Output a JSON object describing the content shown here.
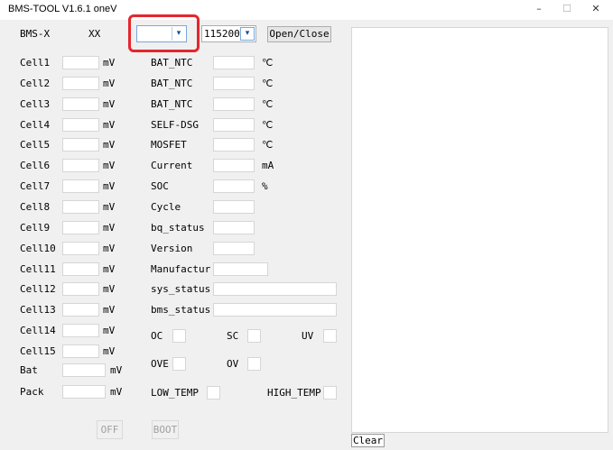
{
  "window": {
    "title": "BMS-TOOL V1.6.1  oneV",
    "minimize": "–",
    "maximize": "☐",
    "close": "✕"
  },
  "header": {
    "device_label": "BMS-X",
    "device_value": "XX",
    "port_value": "",
    "baud_value": "115200",
    "open_close_label": "Open/Close"
  },
  "cells": [
    {
      "label": "Cell1",
      "unit": "mV"
    },
    {
      "label": "Cell2",
      "unit": "mV"
    },
    {
      "label": "Cell3",
      "unit": "mV"
    },
    {
      "label": "Cell4",
      "unit": "mV"
    },
    {
      "label": "Cell5",
      "unit": "mV"
    },
    {
      "label": "Cell6",
      "unit": "mV"
    },
    {
      "label": "Cell7",
      "unit": "mV"
    },
    {
      "label": "Cell8",
      "unit": "mV"
    },
    {
      "label": "Cell9",
      "unit": "mV"
    },
    {
      "label": "Cell10",
      "unit": "mV"
    },
    {
      "label": "Cell11",
      "unit": "mV"
    },
    {
      "label": "Cell12",
      "unit": "mV"
    },
    {
      "label": "Cell13",
      "unit": "mV"
    },
    {
      "label": "Cell14",
      "unit": "mV"
    },
    {
      "label": "Cell15",
      "unit": "mV"
    }
  ],
  "bat": {
    "label": "Bat",
    "unit": "mV"
  },
  "pack": {
    "label": "Pack",
    "unit": "mV"
  },
  "status": [
    {
      "label": "BAT_NTC",
      "unit": "℃"
    },
    {
      "label": "BAT_NTC",
      "unit": "℃"
    },
    {
      "label": "BAT_NTC",
      "unit": "℃"
    },
    {
      "label": "SELF-DSG",
      "unit": "℃"
    },
    {
      "label": "MOSFET",
      "unit": "℃"
    },
    {
      "label": "Current",
      "unit": "mA"
    },
    {
      "label": "SOC",
      "unit": "%"
    },
    {
      "label": "Cycle",
      "unit": ""
    },
    {
      "label": "bq_status",
      "unit": ""
    },
    {
      "label": "Version",
      "unit": ""
    },
    {
      "label": "Manufactur",
      "unit": ""
    },
    {
      "label": "sys_status",
      "unit": ""
    },
    {
      "label": "bms_status",
      "unit": ""
    }
  ],
  "flags": {
    "oc": "OC",
    "sc": "SC",
    "uv": "UV",
    "ove": "OVE",
    "ov": "OV",
    "low_temp": "LOW_TEMP",
    "high_temp": "HIGH_TEMP"
  },
  "buttons": {
    "off": "OFF",
    "boot": "BOOT",
    "clear": "Clear"
  },
  "accent": {
    "highlight": "#e5262c",
    "combo_border": "#7aa7d9"
  }
}
